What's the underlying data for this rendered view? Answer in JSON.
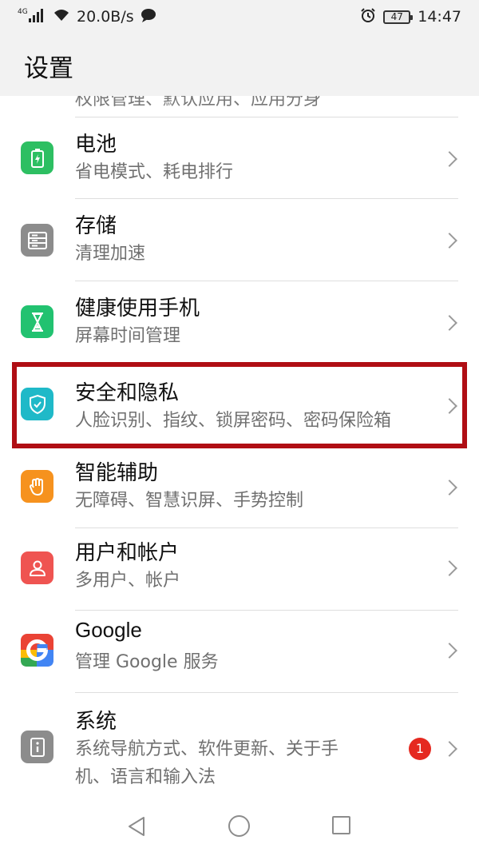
{
  "status_bar": {
    "network": "4G",
    "speed": "20.0B/s",
    "battery": "47",
    "time": "14:47"
  },
  "header": {
    "title": "设置"
  },
  "cut_off_row": {
    "subtitle": "权限管理、默认应用、应用分身"
  },
  "items": [
    {
      "title": "电池",
      "subtitle": "省电模式、耗电排行",
      "icon": "battery-icon",
      "color": "#2dbf62"
    },
    {
      "title": "存储",
      "subtitle": "清理加速",
      "icon": "storage-icon",
      "color": "#8c8c8c"
    },
    {
      "title": "健康使用手机",
      "subtitle": "屏幕时间管理",
      "icon": "hourglass-icon",
      "color": "#22c270"
    },
    {
      "title": "安全和隐私",
      "subtitle": "人脸识别、指纹、锁屏密码、密码保险箱",
      "icon": "shield-icon",
      "color": "#1fb9c8"
    },
    {
      "title": "智能辅助",
      "subtitle": "无障碍、智慧识屏、手势控制",
      "icon": "hand-icon",
      "color": "#f6921e"
    },
    {
      "title": "用户和帐户",
      "subtitle": "多用户、帐户",
      "icon": "user-icon",
      "color": "#ef5451"
    },
    {
      "title": "Google",
      "subtitle": "管理 Google 服务",
      "icon": "google-icon",
      "color": "#ffffff"
    },
    {
      "title": "系统",
      "subtitle": "系统导航方式、软件更新、关于手机、语言和输入法",
      "subtitle_line1": "系统导航方式、软件更新、关于手",
      "subtitle_line2": "机、语言和输入法",
      "icon": "system-icon",
      "color": "#8c8c8c",
      "badge": "1"
    }
  ],
  "highlight": {
    "color": "#b00e14",
    "target": "安全和隐私"
  }
}
